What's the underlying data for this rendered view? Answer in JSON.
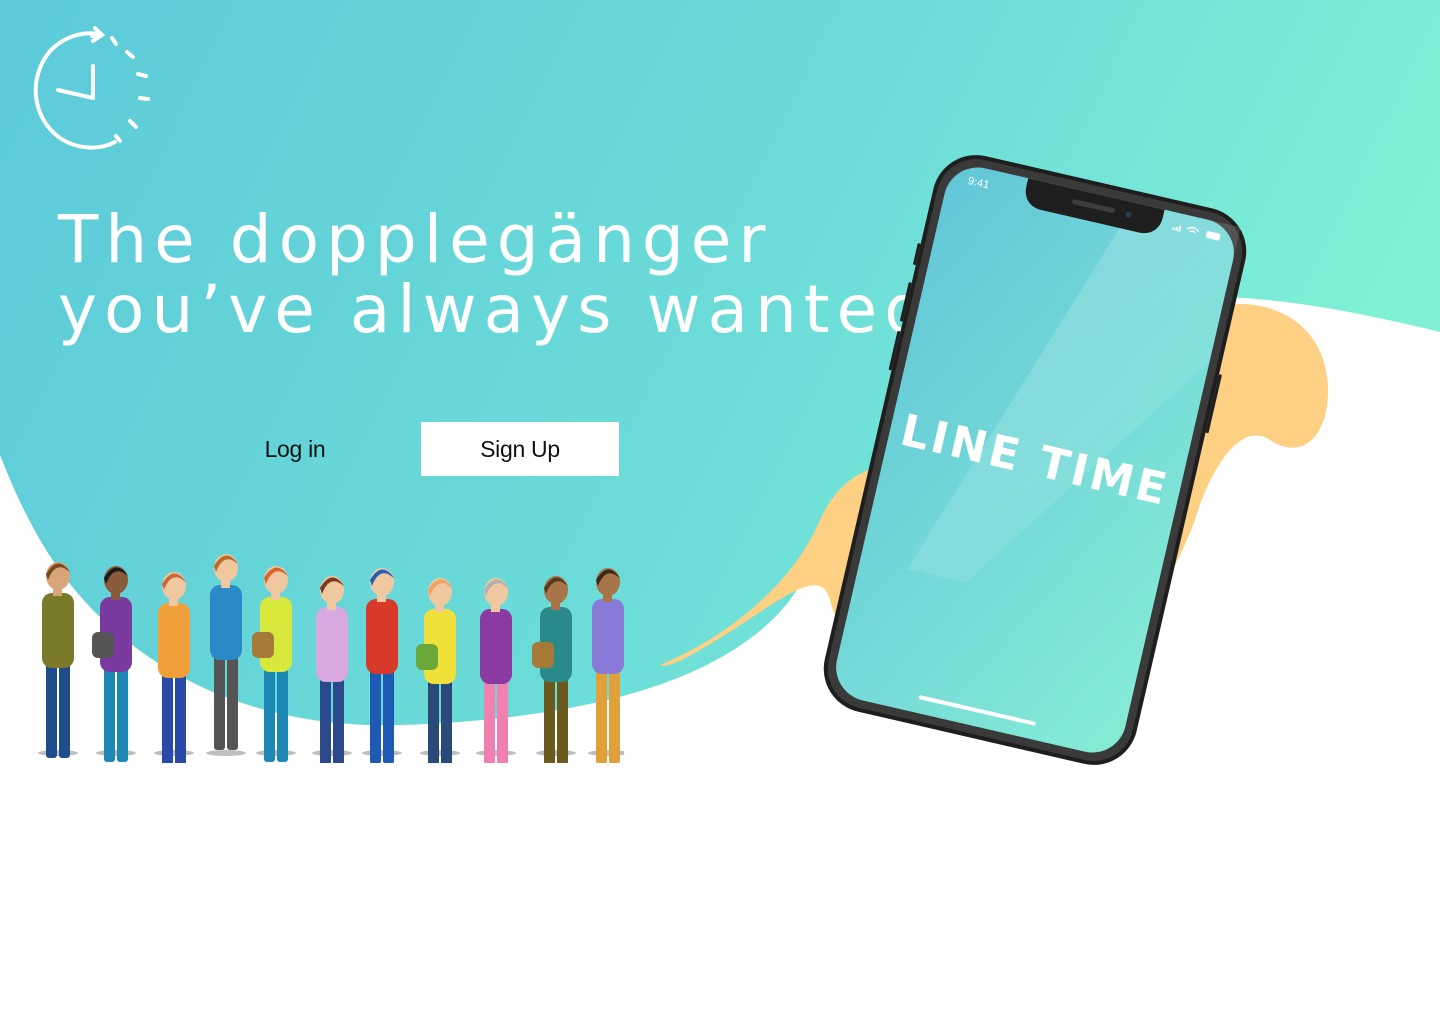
{
  "hero": {
    "headline_line1": "The dopplegänger",
    "headline_line2": "you’ve always wanted"
  },
  "auth": {
    "login_label": "Log in",
    "signup_label": "Sign Up"
  },
  "phone": {
    "status_time": "9:41",
    "app_name": "LINE TIME"
  },
  "colors": {
    "gradient_start": "#5ecbd9",
    "gradient_end": "#7ef0d4",
    "splash": "#fdd083",
    "headline": "#ffffff",
    "signup_bg": "#ffffff",
    "phone_frame": "#222222"
  },
  "icons": [
    "clock-logo-icon",
    "signal-icon",
    "wifi-icon",
    "battery-icon"
  ]
}
